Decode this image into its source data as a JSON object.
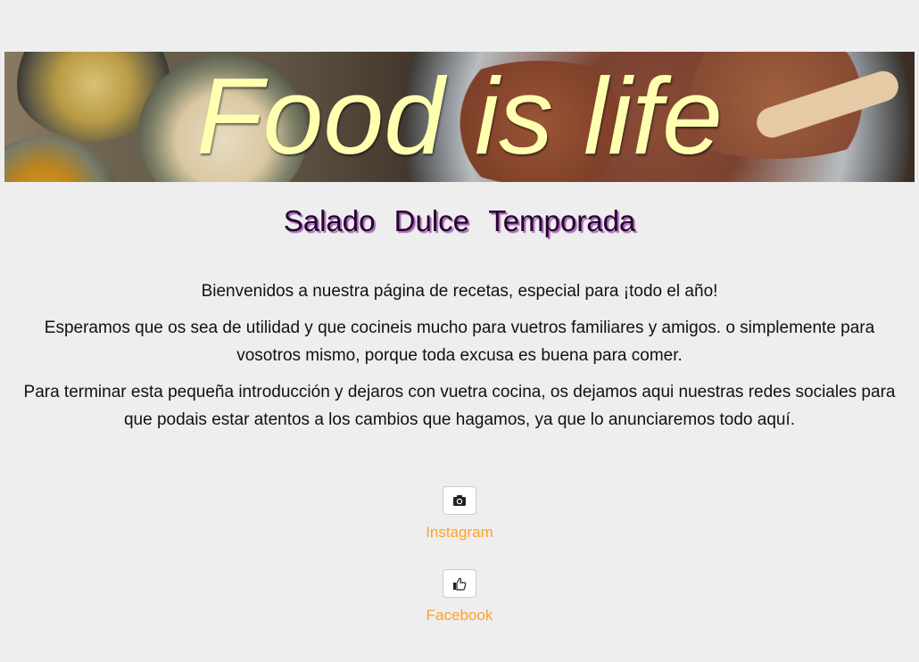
{
  "header": {
    "banner_title": "Food is life"
  },
  "nav": {
    "items": [
      {
        "label": "Salado"
      },
      {
        "label": "Dulce"
      },
      {
        "label": "Temporada"
      }
    ]
  },
  "intro": {
    "paragraphs": [
      "Bienvenidos a nuestra página de recetas, especial para ¡todo el año!",
      "Esperamos que os sea de utilidad y que cocineis mucho para vuetros familiares y amigos. o simplemente para vosotros mismo, porque toda excusa es buena para comer.",
      "Para terminar esta pequeña introducción y dejaros con vuetra cocina, os dejamos aqui nuestras redes sociales para que podais estar atentos a los cambios que hagamos, ya que lo anunciaremos todo aquí."
    ]
  },
  "social": {
    "instagram": {
      "label": "Instagram",
      "icon": "camera-icon"
    },
    "facebook": {
      "label": "Facebook",
      "icon": "thumbs-up-icon"
    }
  },
  "colors": {
    "page_background": "#eeeeee",
    "banner_title": "#ffffb0",
    "nav_text": "#2a0033",
    "nav_shadow": "#a06bb2",
    "social_link": "#ffa127"
  }
}
